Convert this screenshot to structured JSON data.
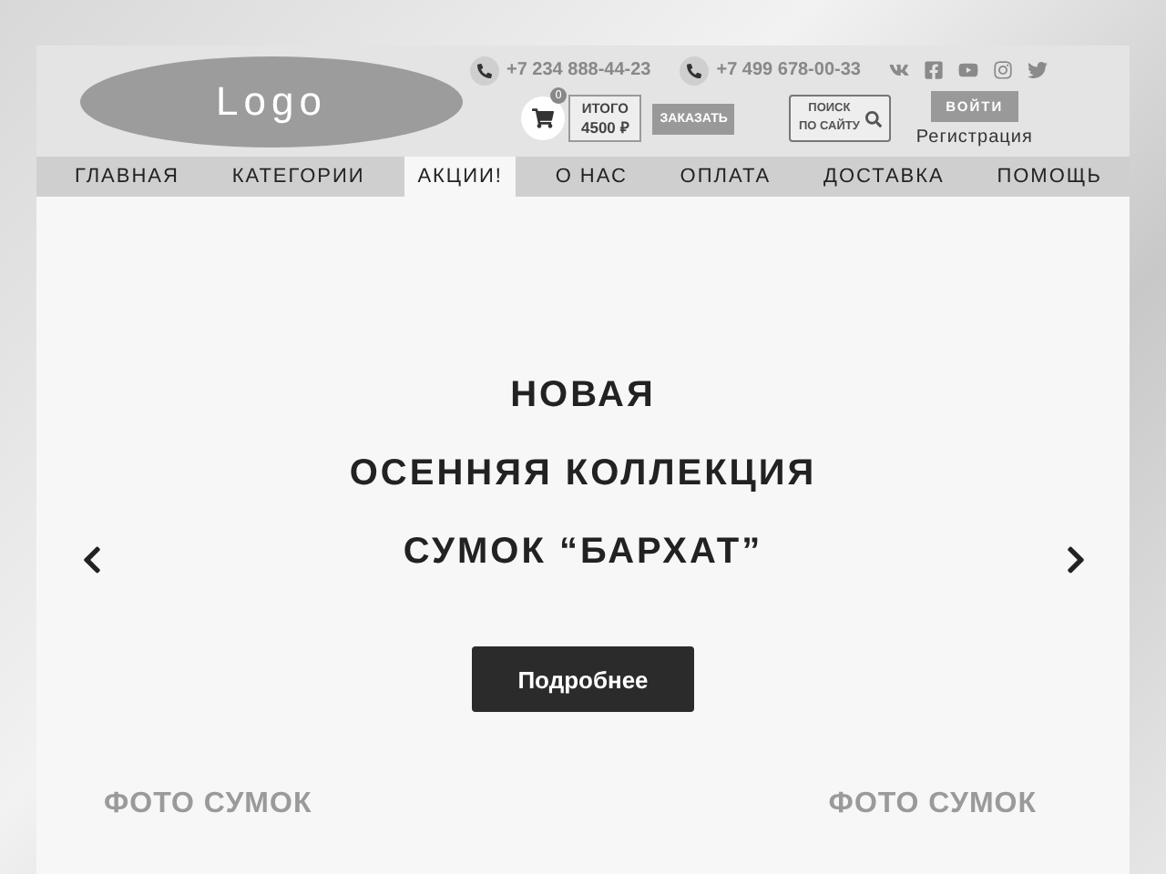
{
  "logo": "Logo",
  "phones": [
    "+7 234 888-44-23",
    "+7 499 678-00-33"
  ],
  "cart": {
    "count": "0",
    "total_label": "ИТОГО",
    "total": "4500 ₽"
  },
  "order_button": "ЗАКАЗАТЬ",
  "search_button": [
    "ПОИСК",
    "ПО САЙТУ"
  ],
  "login_button": "ВОЙТИ",
  "register_link": "Регистрация",
  "nav": [
    {
      "label": "ГЛАВНАЯ",
      "selected": false
    },
    {
      "label": "КАТЕГОРИИ",
      "selected": false
    },
    {
      "label": "АКЦИИ!",
      "selected": true
    },
    {
      "label": "О НАС",
      "selected": false
    },
    {
      "label": "ОПЛАТА",
      "selected": false
    },
    {
      "label": "ДОСТАВКА",
      "selected": false
    },
    {
      "label": "ПОМОЩЬ",
      "selected": false
    }
  ],
  "slide": {
    "title_lines": [
      "НОВАЯ",
      "ОСЕННЯЯ КОЛЛЕКЦИЯ",
      "СУМОК “БАРХАТ”"
    ],
    "button": "Подробнее",
    "photo_labels": [
      "ФОТО СУМОК",
      "ФОТО СУМОК"
    ]
  }
}
